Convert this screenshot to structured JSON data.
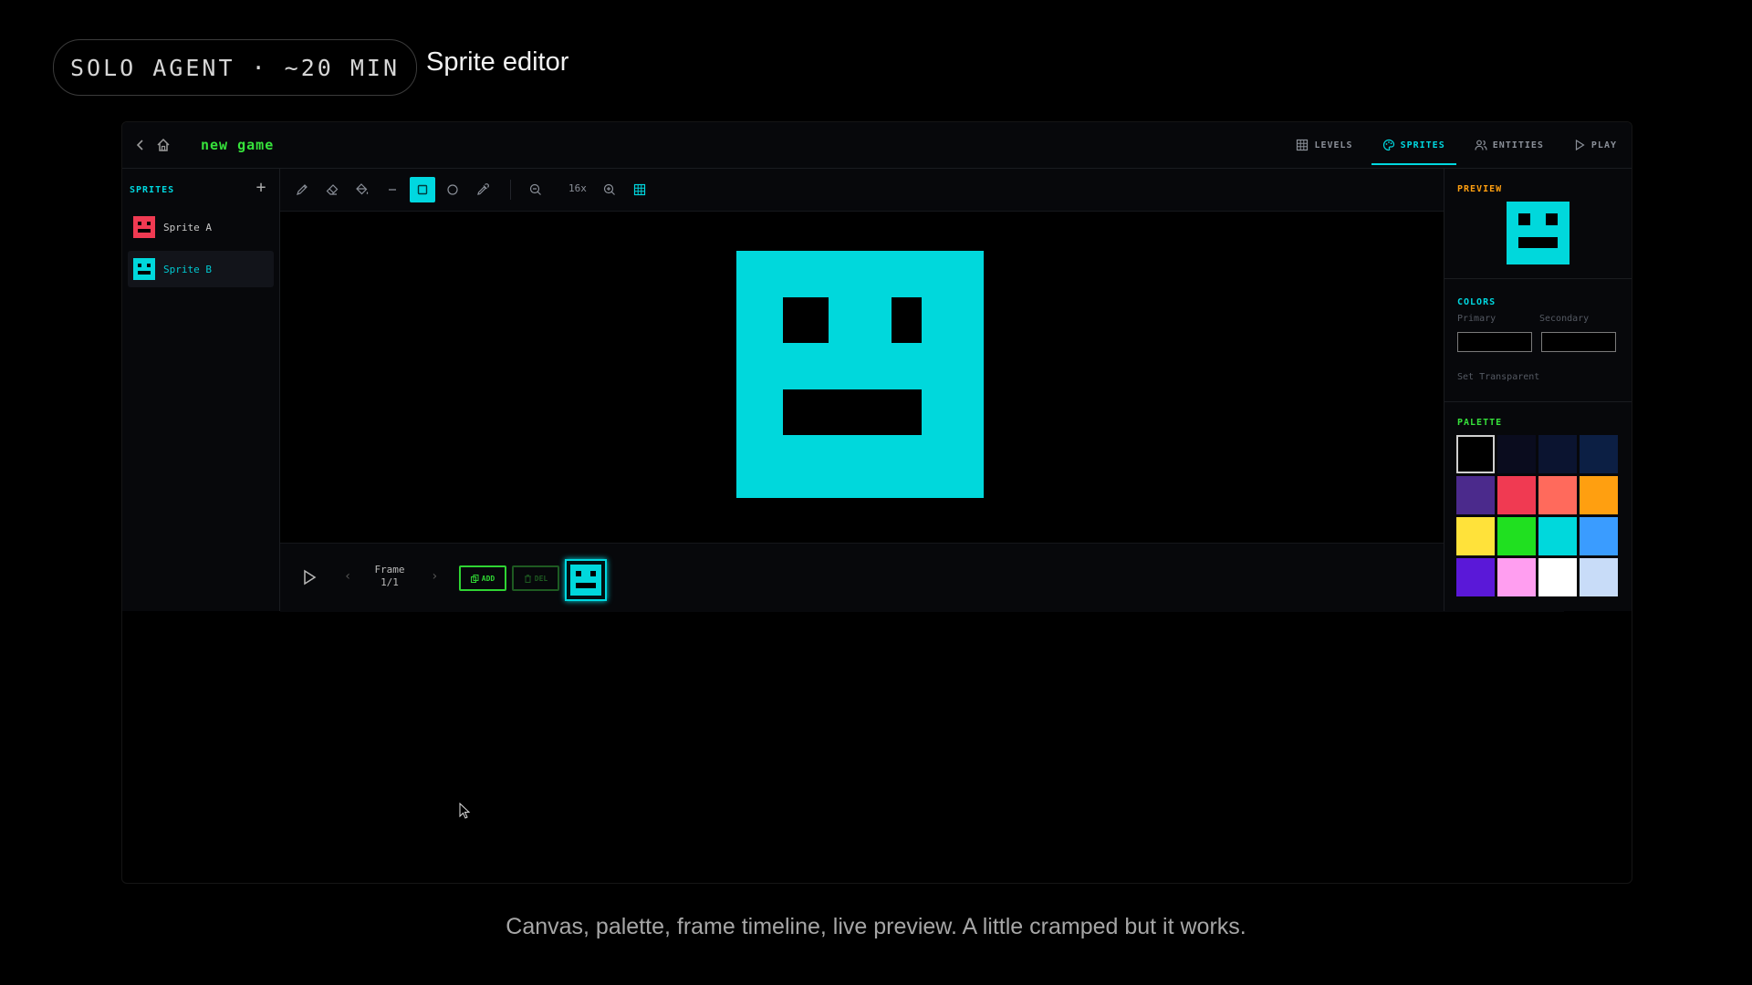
{
  "slide": {
    "badge": "SOLO AGENT · ~20 MIN",
    "title": "Sprite editor",
    "caption": "Canvas, palette, frame timeline, live preview. A little cramped but it works."
  },
  "app": {
    "project_name": "new game",
    "tabs": [
      {
        "label": "LEVELS",
        "icon": "grid-icon",
        "active": false
      },
      {
        "label": "SPRITES",
        "icon": "palette-icon",
        "active": true
      },
      {
        "label": "ENTITIES",
        "icon": "users-icon",
        "active": false
      },
      {
        "label": "PLAY",
        "icon": "play-icon",
        "active": false
      }
    ],
    "sprites_panel": {
      "title": "SPRITES",
      "add_label": "+",
      "items": [
        {
          "label": "Sprite A",
          "color": "#f03a52",
          "selected": false
        },
        {
          "label": "Sprite B",
          "color": "#00d8dc",
          "selected": true
        }
      ]
    },
    "toolbar": {
      "tools": [
        "pencil-icon",
        "eraser-icon",
        "fill-icon",
        "line-icon",
        "rect-icon",
        "ellipse-icon",
        "eyedropper-icon"
      ],
      "active_tool": "rect-icon",
      "zoom_level": "16x"
    },
    "timeline": {
      "frame_label": "Frame",
      "frame_count": "1/1",
      "add_label": "ADD",
      "del_label": "DEL"
    },
    "right_panel": {
      "preview_title": "PREVIEW",
      "colors_title": "COLORS",
      "primary_label": "Primary",
      "secondary_label": "Secondary",
      "set_transparent": "Set Transparent",
      "palette_title": "PALETTE",
      "palette": [
        "#000000",
        "#0a0c1e",
        "#0b1430",
        "#0c1f44",
        "#4b2a8c",
        "#f03a52",
        "#ff6a5c",
        "#ff9f10",
        "#ffe23a",
        "#20e020",
        "#00d8dc",
        "#3a9cff",
        "#5a18d8",
        "#ff9ef0",
        "#ffffff",
        "#c8dcf8"
      ],
      "selected_swatch": 0
    },
    "colors": {
      "accent_cyan": "#00d8e0",
      "accent_green": "#36e23b",
      "title_orange": "#ff9f10"
    }
  }
}
